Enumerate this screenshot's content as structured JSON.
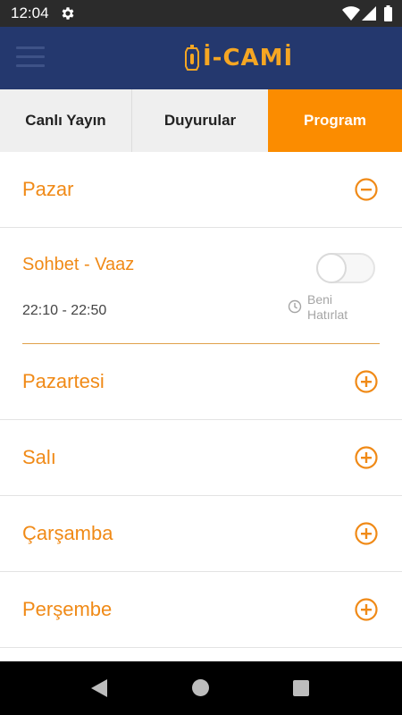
{
  "status_bar": {
    "time": "12:04"
  },
  "app": {
    "logo_text": "İ-CAMİ"
  },
  "tabs": [
    {
      "label": "Canlı Yayın"
    },
    {
      "label": "Duyurular"
    },
    {
      "label": "Program"
    }
  ],
  "days": [
    {
      "label": "Pazar",
      "expanded": true
    },
    {
      "label": "Pazartesi",
      "expanded": false
    },
    {
      "label": "Salı",
      "expanded": false
    },
    {
      "label": "Çarşamba",
      "expanded": false
    },
    {
      "label": "Perşembe",
      "expanded": false
    }
  ],
  "event": {
    "title": "Sohbet - Vaaz",
    "time": "22:10 - 22:50",
    "remind_label_line1": "Beni",
    "remind_label_line2": "Hatırlat",
    "remind_on": false
  },
  "colors": {
    "accent": "#fb8c00",
    "app_bar": "#24386e",
    "status_bar": "#2b2b2b"
  }
}
